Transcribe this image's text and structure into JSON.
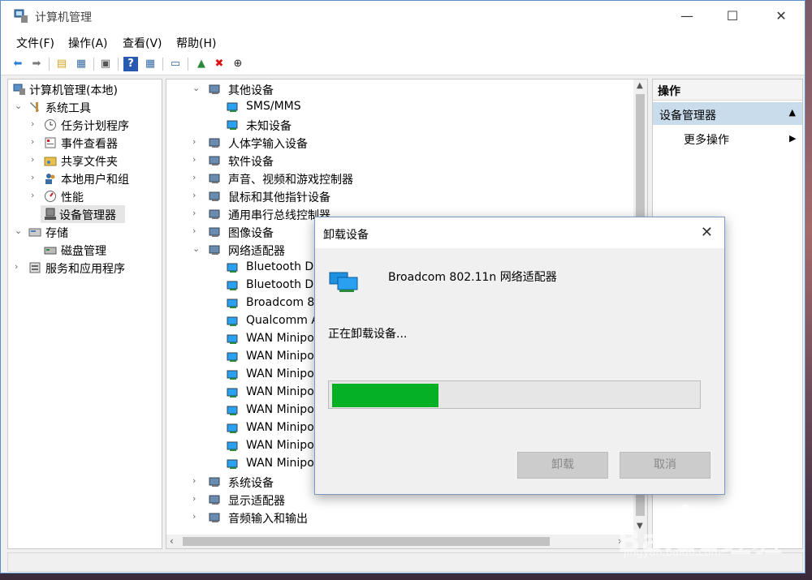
{
  "window": {
    "title": "计算机管理",
    "minimize": "—",
    "maximize": "☐",
    "close": "✕"
  },
  "menu": [
    "文件(F)",
    "操作(A)",
    "查看(V)",
    "帮助(H)"
  ],
  "toolbar": [
    "back-icon",
    "forward-icon",
    "up-folder-icon",
    "show-hide-tree-icon",
    "properties-icon",
    "help-icon",
    "show-hide-action-icon",
    "scan-hardware-icon",
    "update-driver-icon",
    "uninstall-icon",
    "disable-icon"
  ],
  "left_tree": [
    {
      "label": "计算机管理(本地)",
      "level": 0,
      "arrow": ""
    },
    {
      "label": "系统工具",
      "level": 1,
      "arrow": "⌄"
    },
    {
      "label": "任务计划程序",
      "level": 2,
      "arrow": "›"
    },
    {
      "label": "事件查看器",
      "level": 2,
      "arrow": "›"
    },
    {
      "label": "共享文件夹",
      "level": 2,
      "arrow": "›"
    },
    {
      "label": "本地用户和组",
      "level": 2,
      "arrow": "›"
    },
    {
      "label": "性能",
      "level": 2,
      "arrow": "›"
    },
    {
      "label": "设备管理器",
      "level": 2,
      "arrow": "",
      "selected": true
    },
    {
      "label": "存储",
      "level": 1,
      "arrow": "⌄"
    },
    {
      "label": "磁盘管理",
      "level": 2,
      "arrow": ""
    },
    {
      "label": "服务和应用程序",
      "level": 1,
      "arrow": "›"
    }
  ],
  "device_tree": [
    {
      "label": "其他设备",
      "level": 0,
      "arrow": "⌄"
    },
    {
      "label": "SMS/MMS",
      "level": 1
    },
    {
      "label": "未知设备",
      "level": 1
    },
    {
      "label": "人体学输入设备",
      "level": 0,
      "arrow": "›"
    },
    {
      "label": "软件设备",
      "level": 0,
      "arrow": "›"
    },
    {
      "label": "声音、视频和游戏控制器",
      "level": 0,
      "arrow": "›"
    },
    {
      "label": "鼠标和其他指针设备",
      "level": 0,
      "arrow": "›"
    },
    {
      "label": "通用串行总线控制器",
      "level": 0,
      "arrow": "›"
    },
    {
      "label": "图像设备",
      "level": 0,
      "arrow": "›"
    },
    {
      "label": "网络适配器",
      "level": 0,
      "arrow": "⌄"
    },
    {
      "label": "Bluetooth D",
      "level": 1
    },
    {
      "label": "Bluetooth D",
      "level": 1
    },
    {
      "label": "Broadcom 8",
      "level": 1
    },
    {
      "label": "Qualcomm A",
      "level": 1
    },
    {
      "label": "WAN Minipo",
      "level": 1
    },
    {
      "label": "WAN Minipo",
      "level": 1
    },
    {
      "label": "WAN Minipo",
      "level": 1
    },
    {
      "label": "WAN Minipo",
      "level": 1
    },
    {
      "label": "WAN Minipo",
      "level": 1
    },
    {
      "label": "WAN Minipo",
      "level": 1
    },
    {
      "label": "WAN Minipo",
      "level": 1
    },
    {
      "label": "WAN Minipo",
      "level": 1
    },
    {
      "label": "系统设备",
      "level": 0,
      "arrow": "›"
    },
    {
      "label": "显示适配器",
      "level": 0,
      "arrow": "›"
    },
    {
      "label": "音频输入和输出",
      "level": 0,
      "arrow": "›"
    }
  ],
  "actions": {
    "header": "操作",
    "group": "设备管理器",
    "item": "更多操作"
  },
  "dialog": {
    "title": "卸载设备",
    "close": "✕",
    "device_name": "Broadcom 802.11n 网络适配器",
    "status": "正在卸载设备...",
    "progress": 0.29,
    "uninstall_button": "卸载",
    "cancel_button": "取消"
  },
  "watermark": {
    "brand": "Baidu经验",
    "url": "jingyan.baidu.com"
  }
}
